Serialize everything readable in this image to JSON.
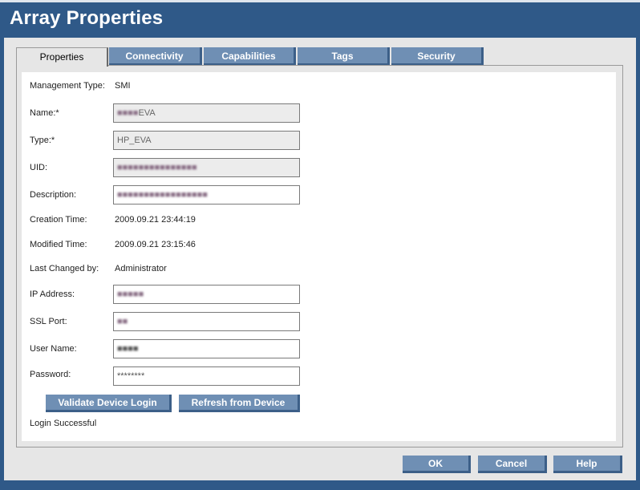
{
  "window": {
    "title": "Array Properties"
  },
  "tabs": [
    {
      "label": "Properties"
    },
    {
      "label": "Connectivity"
    },
    {
      "label": "Capabilities"
    },
    {
      "label": "Tags"
    },
    {
      "label": "Security"
    }
  ],
  "form": {
    "management_type": {
      "label": "Management Type:",
      "value": "SMI"
    },
    "name": {
      "label": "Name:*",
      "value": "EVA"
    },
    "type": {
      "label": "Type:*",
      "value": "HP_EVA"
    },
    "uid": {
      "label": "UID:",
      "value": ""
    },
    "description": {
      "label": "Description:",
      "value": ""
    },
    "creation_time": {
      "label": "Creation Time:",
      "value": "2009.09.21 23:44:19"
    },
    "modified_time": {
      "label": "Modified Time:",
      "value": "2009.09.21 23:15:46"
    },
    "last_changed_by": {
      "label": "Last Changed by:",
      "value": "Administrator"
    },
    "ip_address": {
      "label": "IP Address:",
      "value": ""
    },
    "ssl_port": {
      "label": "SSL Port:",
      "value": ""
    },
    "user_name": {
      "label": "User Name:",
      "value": ""
    },
    "password": {
      "label": "Password:",
      "value": "********"
    }
  },
  "buttons": {
    "validate": "Validate Device Login",
    "refresh": "Refresh from Device",
    "ok": "OK",
    "cancel": "Cancel",
    "help": "Help"
  },
  "status": {
    "message": "Login Successful"
  }
}
